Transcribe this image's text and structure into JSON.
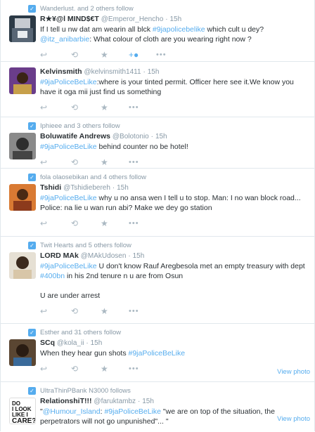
{
  "tweets": [
    {
      "context": "Wanderlust. and 2 others follow",
      "fullname": "R★¥@l MIND$€T",
      "username": "@Emperor_Hencho",
      "time": "15h",
      "text1": "If I tell u nw dat am wearin all blck ",
      "tag1": "#9japolicebelike",
      "text2": " which cult u dey?",
      "mention": "@itz_anibarbie",
      "text3": ": What colour of cloth are you wearing right now ?"
    },
    {
      "fullname": "Kelvinsmith",
      "username": "@kelvinsmith1411",
      "time": "15h",
      "tag1": "#9jaPoliceBeLike",
      "text1": ":where is your tinted permit. Officer here see it.We know you have it oga mii just find us something"
    },
    {
      "context": "Iphieee and 3 others follow",
      "fullname": "Boluwatife Andrews",
      "username": "@Bolotonio",
      "time": "15h",
      "tag1": "#9jaPoliceBeLike",
      "text1": " behind counter no be hotel!"
    },
    {
      "context": "fola olaosebikan and 4 others follow",
      "fullname": "Tshidi",
      "username": "@Tshidiebereh",
      "time": "15h",
      "tag1": "#9jaPoliceBeLike",
      "text1": " why u no ansa wen I tell u to stop. Man: I no wan block road... Police: na lie u wan run abi? Make we dey go station"
    },
    {
      "context": "Twit Hearts and 5 others follow",
      "fullname": "LORD MAk",
      "username": "@MAkUdosen",
      "time": "15h",
      "tag1": "#9jaPoliceBeLike",
      "text1": " U don't know Rauf Aregbesola met an empty treasury with dept ",
      "tag2": "#400bn",
      "text2": " in his 2nd tenure n u are from Osun",
      "text3": "U are under arrest"
    },
    {
      "context": "Esther and 31 others follow",
      "fullname": "SCq",
      "username": "@kola_ii",
      "time": "15h",
      "text1": "When they hear gun shots ",
      "tag1": "#9jaPoliceBeLike",
      "view_photo": "View photo"
    },
    {
      "context": "UltraThinPBank N3000 follows",
      "fullname": "RelationshiT!!!",
      "username": "@faruktambz",
      "time": "15h",
      "text1": "\"",
      "mention": "@Humour_Island",
      "text2": ": ",
      "tag1": "#9jaPoliceBeLike",
      "text3": " \"we are on top of the situation, the perpetrators will not go unpunished\"... \"",
      "view_photo": "View photo",
      "avatar_text": "DO I LOOK LIKE I CARE?"
    }
  ],
  "dot": "·",
  "icons": {
    "reply": "reply-icon",
    "retweet": "retweet-icon",
    "favorite": "star-icon",
    "follow": "follow-icon",
    "more": "more-icon",
    "context": "bird-icon"
  },
  "colors": {
    "link": "#55acee",
    "muted": "#8899a6",
    "text": "#292f33",
    "action": "#aab8c2"
  }
}
